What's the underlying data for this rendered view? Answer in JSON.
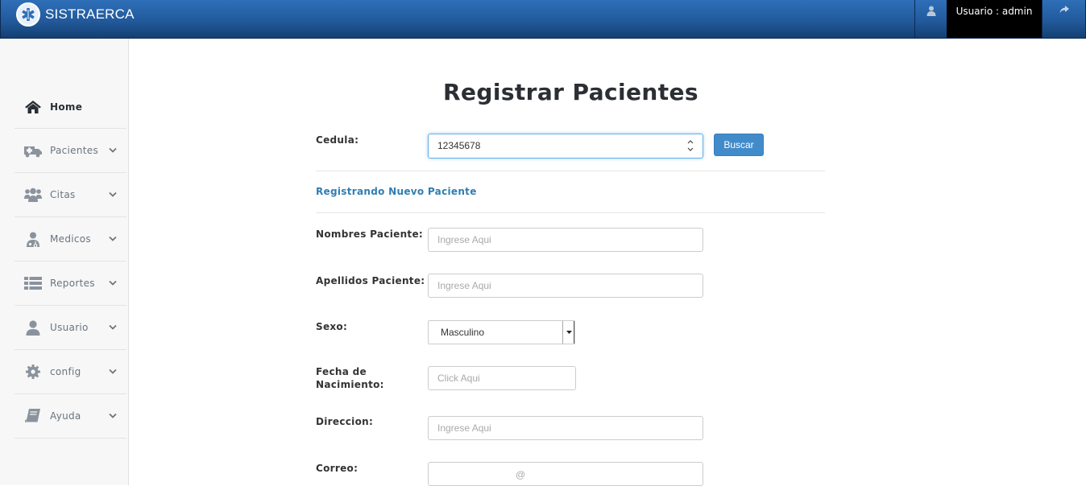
{
  "header": {
    "brand": "SISTRAERCA",
    "user_text": "Usuario : admin"
  },
  "sidebar": {
    "items": [
      {
        "label": "Home",
        "icon": "home-icon"
      },
      {
        "label": "Pacientes",
        "icon": "ambulance-icon"
      },
      {
        "label": "Citas",
        "icon": "users-icon"
      },
      {
        "label": "Medicos",
        "icon": "doctor-icon"
      },
      {
        "label": "Reportes",
        "icon": "list-icon"
      },
      {
        "label": "Usuario",
        "icon": "user-icon"
      },
      {
        "label": "config",
        "icon": "gear-icon"
      },
      {
        "label": "Ayuda",
        "icon": "book-icon"
      }
    ]
  },
  "form": {
    "title": "Registrar Pacientes",
    "cedula_label": "Cedula:",
    "cedula_value": "12345678",
    "buscar_label": "Buscar",
    "section_title": "Registrando Nuevo Paciente",
    "nombres_label": "Nombres Paciente:",
    "nombres_placeholder": "Ingrese Aqui",
    "apellidos_label": "Apellidos Paciente:",
    "apellidos_placeholder": "Ingrese Aqui",
    "sexo_label": "Sexo:",
    "sexo_value": "Masculino",
    "fecha_label_1": "Fecha de",
    "fecha_label_2": "Nacimiento:",
    "fecha_placeholder": "Click Aqui",
    "direccion_label": "Direccion:",
    "direccion_placeholder": "Ingrese Aqui",
    "correo_label": "Correo:",
    "correo_at": "@"
  },
  "colors": {
    "header_blue": "#225a9c",
    "primary_button": "#428bca",
    "section_title": "#2f7eb3"
  }
}
